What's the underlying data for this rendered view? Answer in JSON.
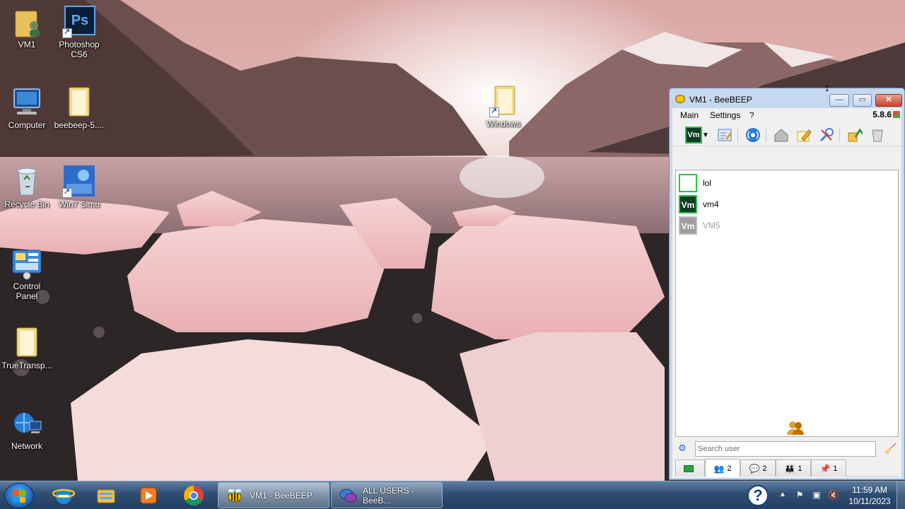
{
  "desktop": {
    "icons": [
      {
        "label": "VM1"
      },
      {
        "label": "Photoshop CS6"
      },
      {
        "label": "Computer"
      },
      {
        "label": "beebeep-5...."
      },
      {
        "label": "Windows"
      },
      {
        "label": "Recycle Bin"
      },
      {
        "label": "Win7 Simu"
      },
      {
        "label": "Control Panel"
      },
      {
        "label": "TrueTransp..."
      },
      {
        "label": "Network"
      }
    ],
    "photoshop_badge": "Ps"
  },
  "beebeep": {
    "title": "VM1 - BeeBEEP",
    "menu": [
      "Main",
      "Settings",
      "?"
    ],
    "version": "5.8.6",
    "avatar_text": "Vm",
    "users": [
      {
        "name": "lol",
        "avatar": ""
      },
      {
        "name": "vm4",
        "avatar": "Vm"
      },
      {
        "name": "VM5",
        "avatar": "Vm"
      }
    ],
    "search_placeholder": "Search user",
    "tabs": [
      {
        "count": ""
      },
      {
        "count": "2"
      },
      {
        "count": "2"
      },
      {
        "count": "1"
      },
      {
        "count": "1"
      }
    ],
    "colors": {
      "online": "#28c245",
      "offline": "#9e9e9e",
      "avatar_bg": "#0e3b24"
    }
  },
  "taskbar": {
    "buttons": [
      {
        "label": "VM1 - BeeBEEP"
      },
      {
        "label": "ALL USERS - BeeB..."
      }
    ],
    "help_icon": "?",
    "clock": {
      "time": "11:59 AM",
      "date": "10/11/2023"
    }
  }
}
